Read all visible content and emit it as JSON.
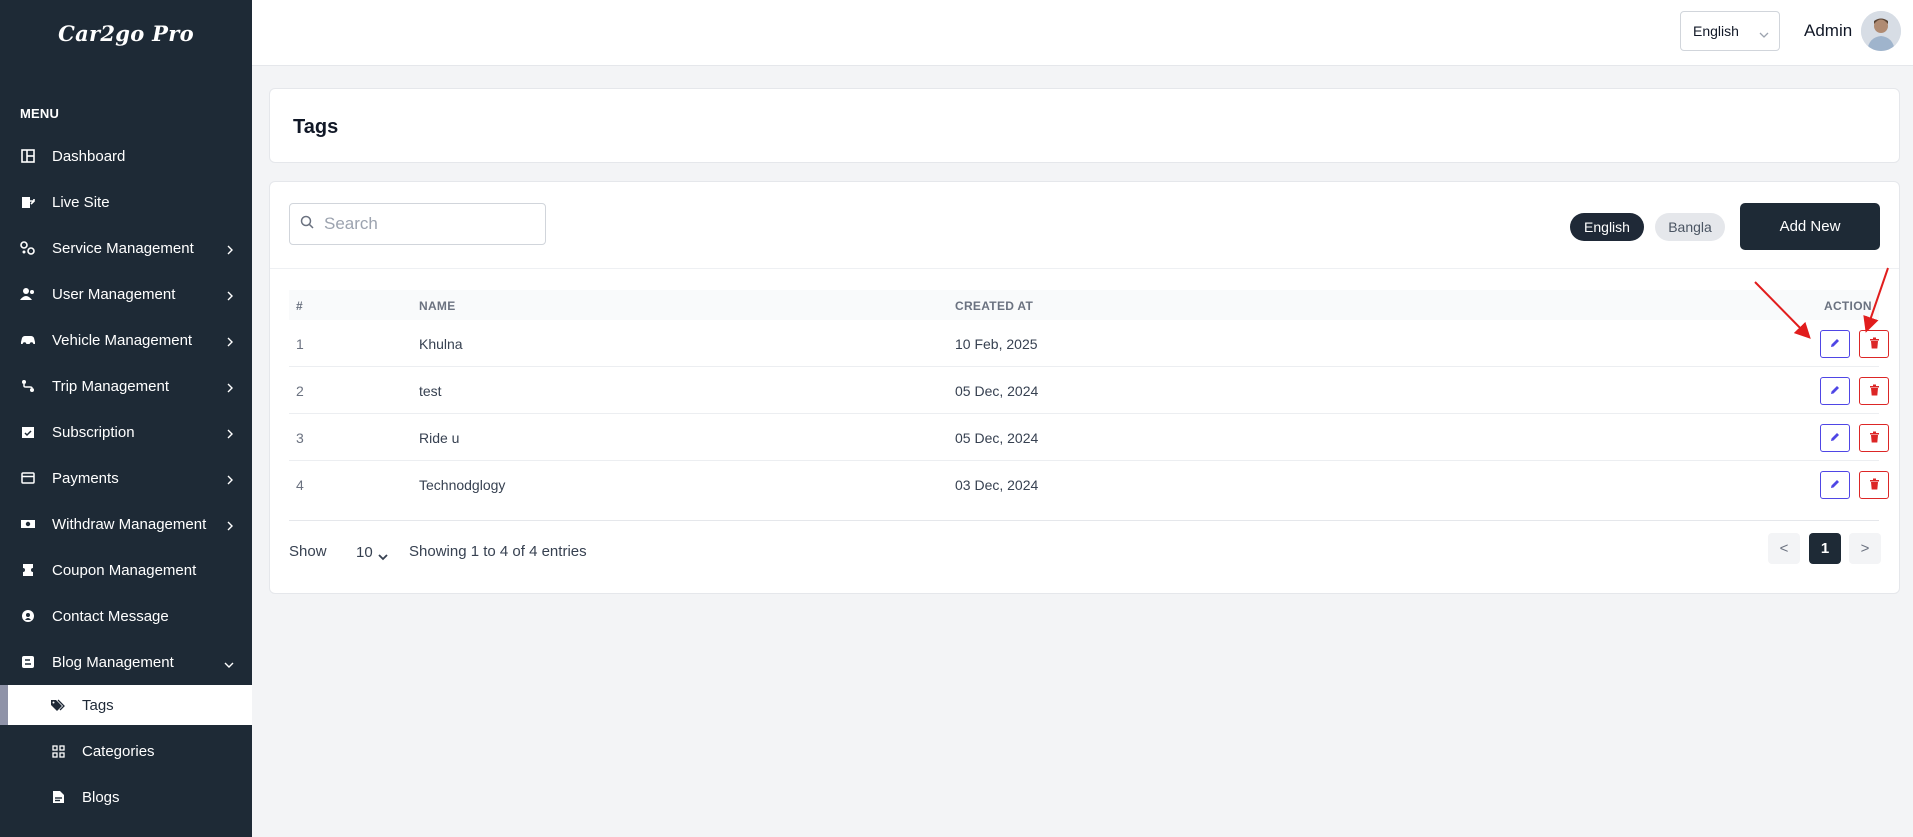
{
  "app": {
    "logo_text": "Car2go Pro"
  },
  "sidebar": {
    "menu_label": "MENU",
    "items": [
      {
        "label": "Dashboard",
        "icon": "dashboard-icon",
        "has_children": false
      },
      {
        "label": "Live Site",
        "icon": "external-site-icon",
        "has_children": false
      },
      {
        "label": "Service Management",
        "icon": "services-icon",
        "has_children": true
      },
      {
        "label": "User Management",
        "icon": "users-icon",
        "has_children": true
      },
      {
        "label": "Vehicle Management",
        "icon": "car-icon",
        "has_children": true
      },
      {
        "label": "Trip Management",
        "icon": "route-icon",
        "has_children": true
      },
      {
        "label": "Subscription",
        "icon": "subscription-icon",
        "has_children": true
      },
      {
        "label": "Payments",
        "icon": "credit-card-icon",
        "has_children": true
      },
      {
        "label": "Withdraw Management",
        "icon": "money-icon",
        "has_children": true
      },
      {
        "label": "Coupon Management",
        "icon": "coupon-icon",
        "has_children": false
      },
      {
        "label": "Contact Message",
        "icon": "contact-icon",
        "has_children": false
      },
      {
        "label": "Blog Management",
        "icon": "blog-icon",
        "has_children": true,
        "expanded": true
      }
    ],
    "blog_children": [
      {
        "label": "Tags",
        "icon": "tags-icon",
        "active": true
      },
      {
        "label": "Categories",
        "icon": "grid-icon",
        "active": false
      },
      {
        "label": "Blogs",
        "icon": "blog-post-icon",
        "active": false
      }
    ]
  },
  "topbar": {
    "language": "English",
    "user_name": "Admin"
  },
  "page": {
    "title": "Tags"
  },
  "toolbar": {
    "search_placeholder": "Search",
    "lang_english": "English",
    "lang_bangla": "Bangla",
    "add_new_label": "Add New"
  },
  "table": {
    "columns": [
      "#",
      "NAME",
      "CREATED AT",
      "ACTION"
    ],
    "rows": [
      {
        "num": "1",
        "name": "Khulna",
        "created_at": "10 Feb, 2025"
      },
      {
        "num": "2",
        "name": "test",
        "created_at": "05 Dec, 2024"
      },
      {
        "num": "3",
        "name": "Ride u",
        "created_at": "05 Dec, 2024"
      },
      {
        "num": "4",
        "name": "Technodglogy",
        "created_at": "03 Dec, 2024"
      }
    ]
  },
  "footer": {
    "show_label": "Show",
    "page_size": "10",
    "entries_text": "Showing 1 to 4 of 4 entries",
    "prev_label": "<",
    "current_page": "1",
    "next_label": ">"
  },
  "colors": {
    "sidebar_bg": "#1e2a36",
    "edit_accent": "#4f46e5",
    "delete_accent": "#dc2626",
    "annotation_arrow": "#e11d1d"
  }
}
